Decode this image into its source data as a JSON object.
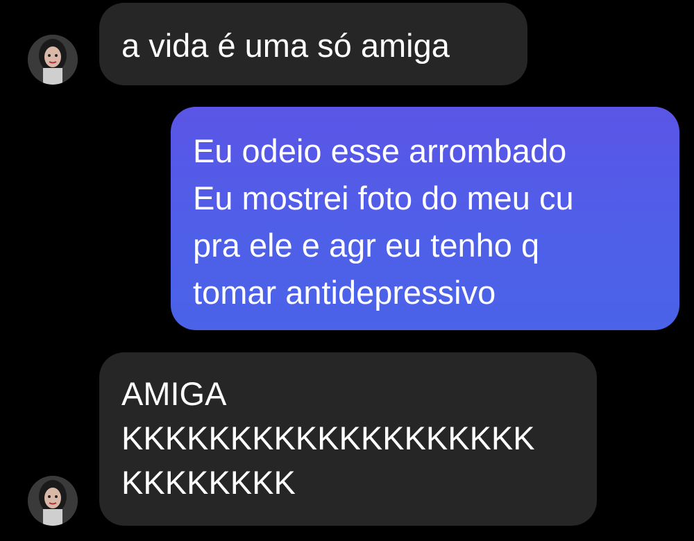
{
  "messages": [
    {
      "sender": "contact",
      "lines": [
        "a vida é uma só amiga"
      ]
    },
    {
      "sender": "me",
      "lines": [
        "Eu odeio esse arrombado",
        "Eu mostrei foto do meu cu",
        "pra ele e agr eu tenho q",
        "tomar antidepressivo"
      ]
    },
    {
      "sender": "contact",
      "lines": [
        "AMIGA",
        "KKKKKKKKKKKKKKKKKKK",
        "KKKKKKKK"
      ]
    }
  ],
  "colors": {
    "background": "#000000",
    "incoming_bubble": "#262626",
    "outgoing_bubble_top": "#5a55e6",
    "outgoing_bubble_bottom": "#4a63e8",
    "text": "#ffffff"
  },
  "icons": {
    "avatar": "contact-avatar-icon"
  }
}
